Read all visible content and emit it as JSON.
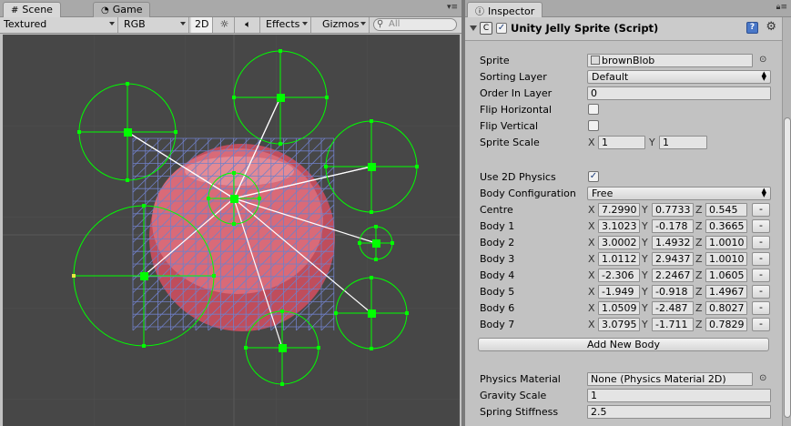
{
  "scene_panel": {
    "tabs": [
      {
        "label": "Scene",
        "icon": "grid-icon"
      },
      {
        "label": "Game",
        "icon": "pacman-icon"
      }
    ],
    "toolbar": {
      "draw_mode": "Textured",
      "render_mode": "RGB",
      "mode_2d": "2D",
      "effects": "Effects",
      "gizmos": "Gizmos",
      "search_placeholder": "All"
    },
    "colors": {
      "background": "#474747",
      "blob_fill": "#d06070",
      "handle_green": "#00ff00",
      "grid_blue": "#7080c8"
    }
  },
  "inspector": {
    "tab_label": "Inspector",
    "component": {
      "title": "Unity Jelly Sprite (Script)",
      "enabled": true
    },
    "fields": {
      "sprite": {
        "label": "Sprite",
        "value": "brownBlob"
      },
      "sorting_layer": {
        "label": "Sorting Layer",
        "value": "Default"
      },
      "order_in_layer": {
        "label": "Order In Layer",
        "value": "0"
      },
      "flip_horizontal": {
        "label": "Flip Horizontal",
        "checked": false
      },
      "flip_vertical": {
        "label": "Flip Vertical",
        "checked": false
      },
      "sprite_scale": {
        "label": "Sprite Scale",
        "x": "1",
        "y": "1"
      },
      "use_2d_physics": {
        "label": "Use 2D Physics",
        "checked": true
      },
      "body_configuration": {
        "label": "Body Configuration",
        "value": "Free"
      },
      "bodies": [
        {
          "label": "Centre",
          "x": "7.2990",
          "y": "0.7733",
          "z": "0.545"
        },
        {
          "label": "Body 1",
          "x": "3.1023",
          "y": "-0.178",
          "z": "0.3665"
        },
        {
          "label": "Body 2",
          "x": "3.0002",
          "y": "1.4932",
          "z": "1.0010"
        },
        {
          "label": "Body 3",
          "x": "1.0112",
          "y": "2.9437",
          "z": "1.0010"
        },
        {
          "label": "Body 4",
          "x": "-2.306",
          "y": "2.2467",
          "z": "1.0605"
        },
        {
          "label": "Body 5",
          "x": "-1.949",
          "y": "-0.918",
          "z": "1.4967"
        },
        {
          "label": "Body 6",
          "x": "1.0509",
          "y": "-2.487",
          "z": "0.8027"
        },
        {
          "label": "Body 7",
          "x": "3.0795",
          "y": "-1.711",
          "z": "0.7829"
        }
      ],
      "add_new_body": "Add New Body",
      "physics_material": {
        "label": "Physics Material",
        "value": "None (Physics Material 2D)"
      },
      "gravity_scale": {
        "label": "Gravity Scale",
        "value": "1"
      },
      "spring_stiffness": {
        "label": "Spring Stiffness",
        "value": "2.5"
      }
    },
    "axis_labels": {
      "x": "X",
      "y": "Y",
      "z": "Z"
    },
    "minus_label": "-"
  }
}
